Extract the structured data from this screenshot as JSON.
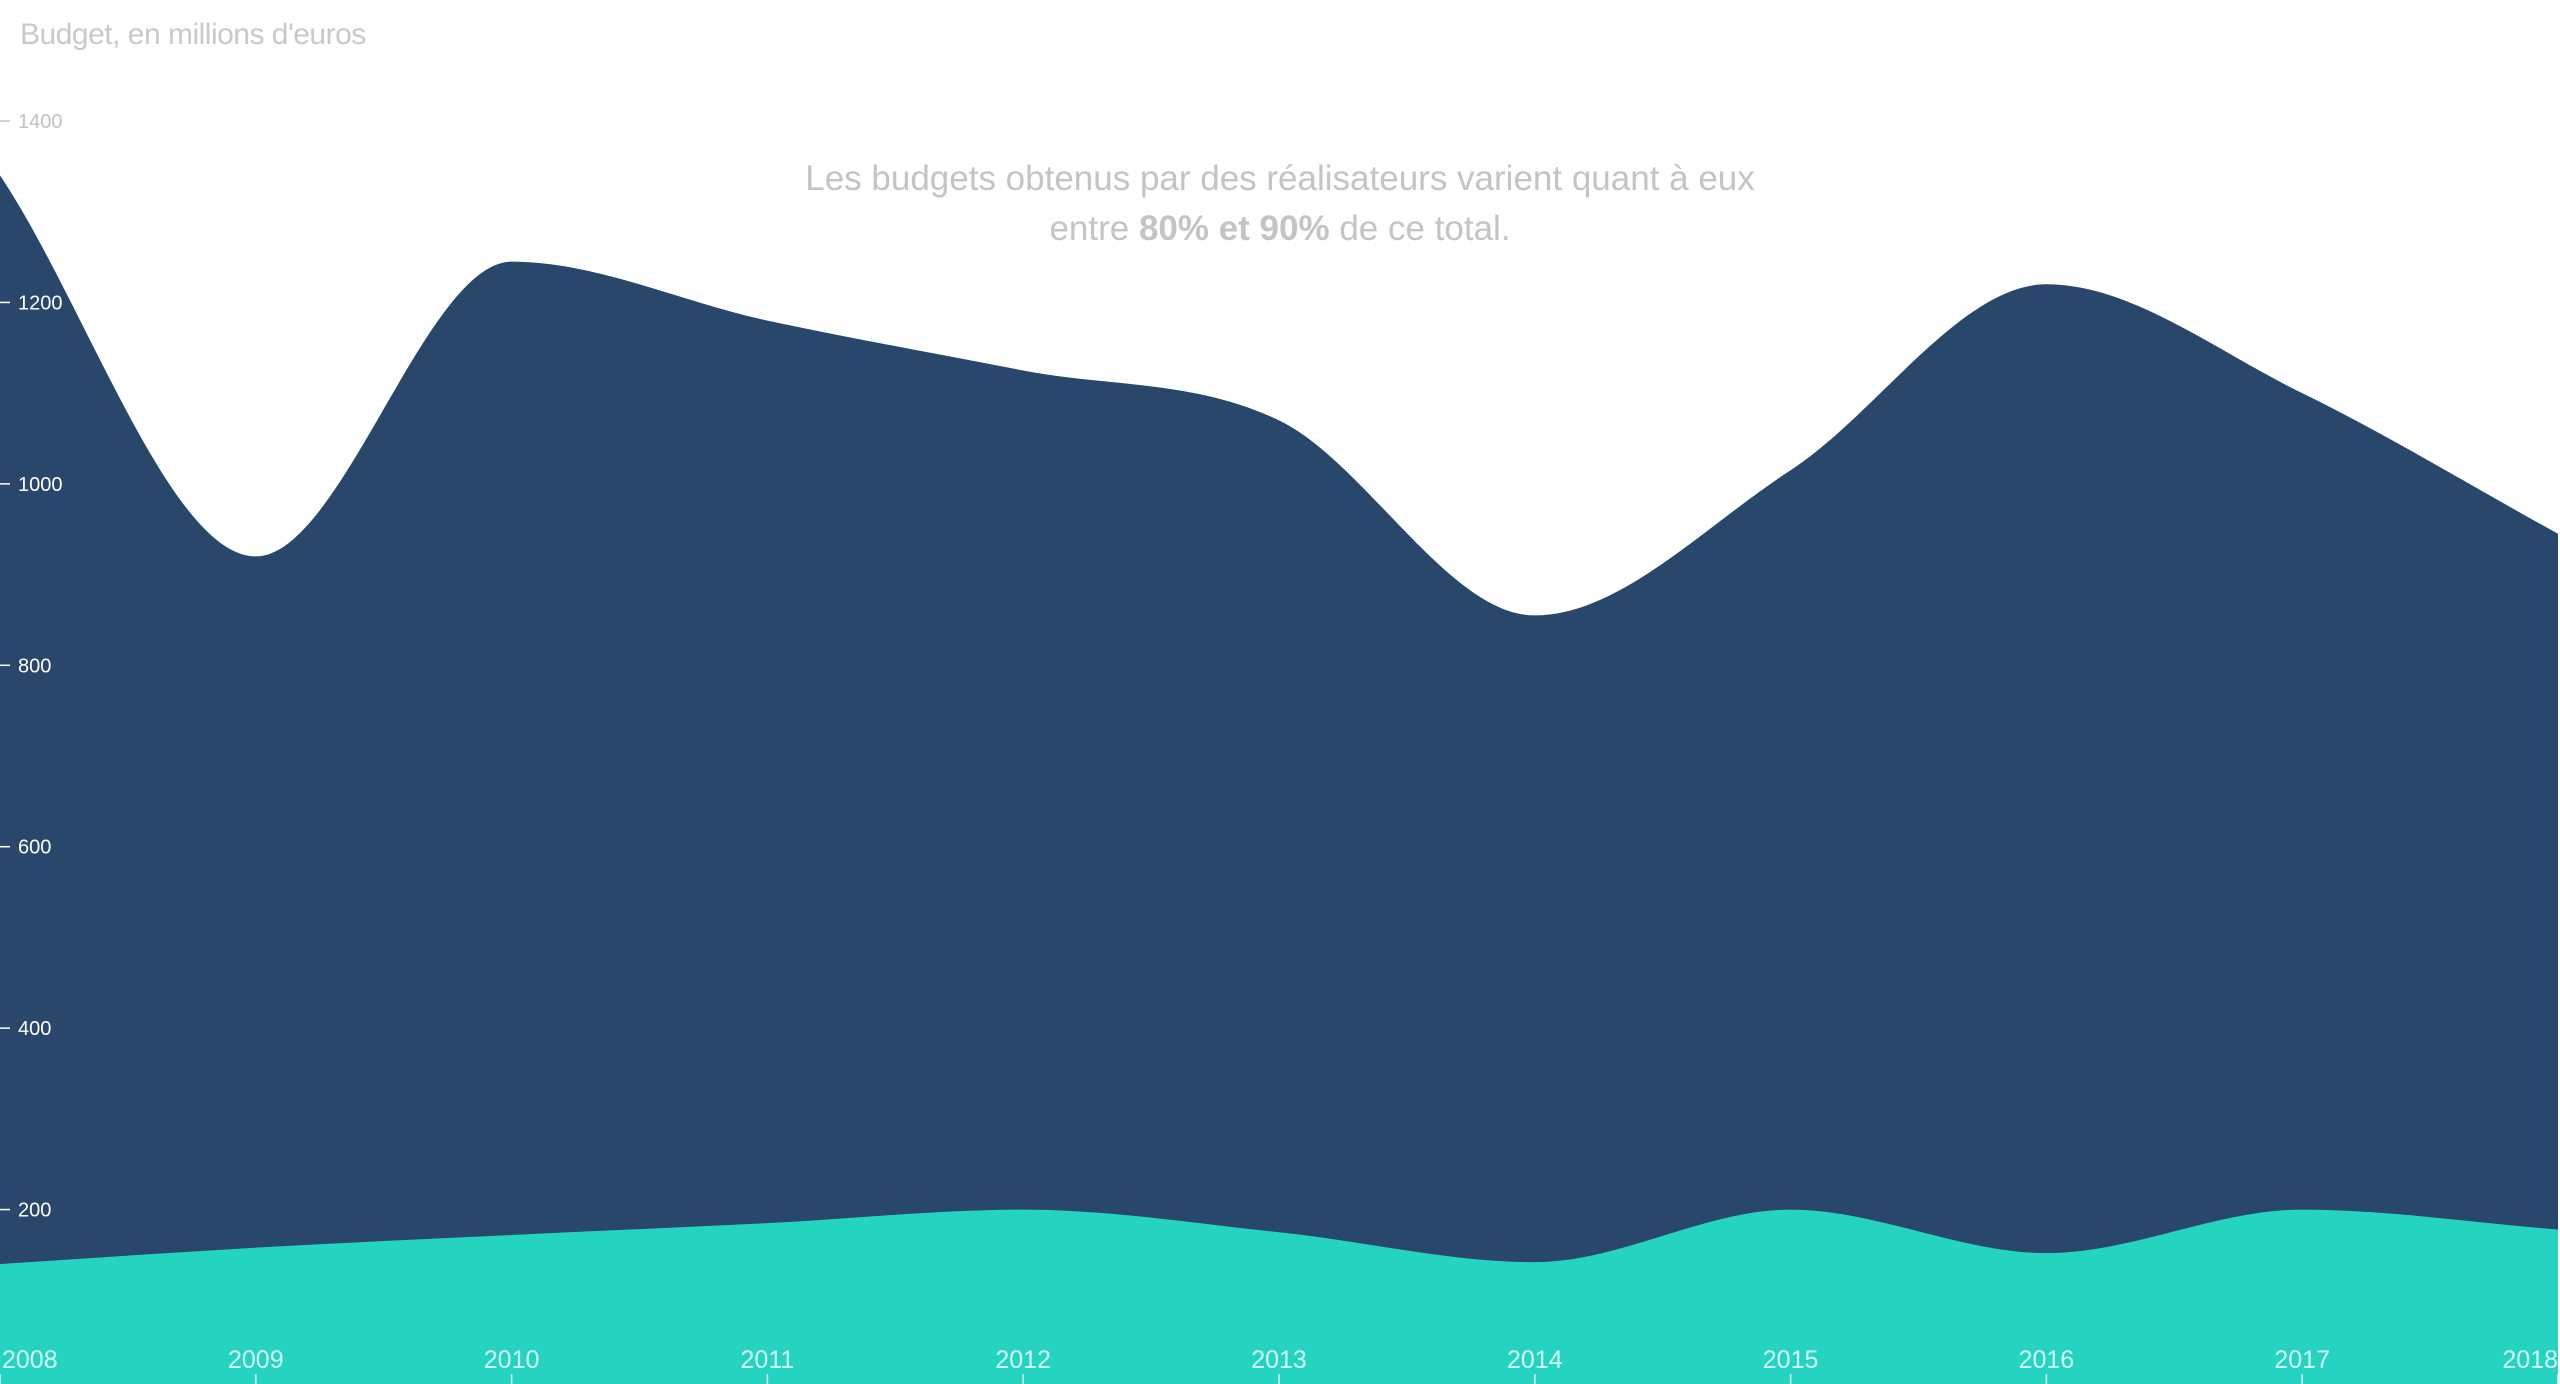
{
  "chart_data": {
    "type": "area",
    "ylabel": "Budget, en millions d'euros",
    "xlabel": "",
    "x": [
      "2008",
      "2009",
      "2010",
      "2011",
      "2012",
      "2013",
      "2014",
      "2015",
      "2016",
      "2017",
      "2018"
    ],
    "ylim": [
      0,
      1400
    ],
    "yticks": [
      200,
      400,
      600,
      800,
      1000,
      1200,
      1400
    ],
    "series": [
      {
        "values": [
          1340,
          920,
          1245,
          1180,
          1125,
          1070,
          855,
          1015,
          1220,
          1100,
          945
        ],
        "color": "#28476b"
      },
      {
        "values": [
          140,
          158,
          172,
          185,
          200,
          175,
          142,
          200,
          152,
          200,
          178
        ],
        "color": "#24d4c0"
      }
    ],
    "annotation": {
      "line1": "Les budgets obtenus par des réalisateurs varient quant à eux",
      "line2_pre": "entre ",
      "line2_bold": "80% et 90%",
      "line2_post": " de ce total."
    },
    "colors": {
      "ytick_on_white": "#c2c2c2",
      "ytick_on_dark": "#ffffff",
      "xtick": "#d7fbf6",
      "label": "#c9c9c9"
    }
  }
}
